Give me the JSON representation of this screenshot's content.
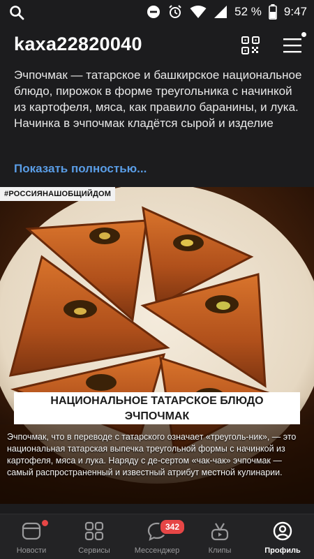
{
  "statusbar": {
    "battery_percent": "52 %",
    "time": "9:47"
  },
  "profile": {
    "username": "kaxa22820040"
  },
  "post": {
    "description": "Эчпочмак — татарское и башкирское национальное блюдо, пирожок в форме треугольника с начинкой из картофеля, мяса, как правило баранины, и лука. Начинка в эчпочмак кладётся сырой и изделие",
    "show_more": "Показать полностью...",
    "image": {
      "hashtag": "#РОССИЯНАШОБЩИЙДОМ",
      "title_line1": "НАЦИОНАЛЬНОЕ ТАТАРСКОЕ БЛЮДО",
      "title_line2": "ЭЧПОЧМАК",
      "caption": "Эчпочмак, что в переводе с татарского означает «треуголь-ник», — это национальная татарская выпечка треугольной формы с начинкой из картофеля, мяса и лука. Наряду с де-сертом «чак-чак» эчпочмак — самый распространенный и известный атрибут местной кулинарии."
    }
  },
  "tabbar": {
    "tabs": [
      {
        "label": "Новости",
        "icon": "news-icon"
      },
      {
        "label": "Сервисы",
        "icon": "services-icon"
      },
      {
        "label": "Мессенджер",
        "icon": "messenger-icon",
        "badge": "342"
      },
      {
        "label": "Клипы",
        "icon": "clips-icon"
      },
      {
        "label": "Профиль",
        "icon": "profile-icon",
        "active": true
      }
    ]
  },
  "colors": {
    "background": "#1c1c1e",
    "link": "#5a9de6",
    "badge": "#e64646",
    "tabbar": "#232325"
  }
}
